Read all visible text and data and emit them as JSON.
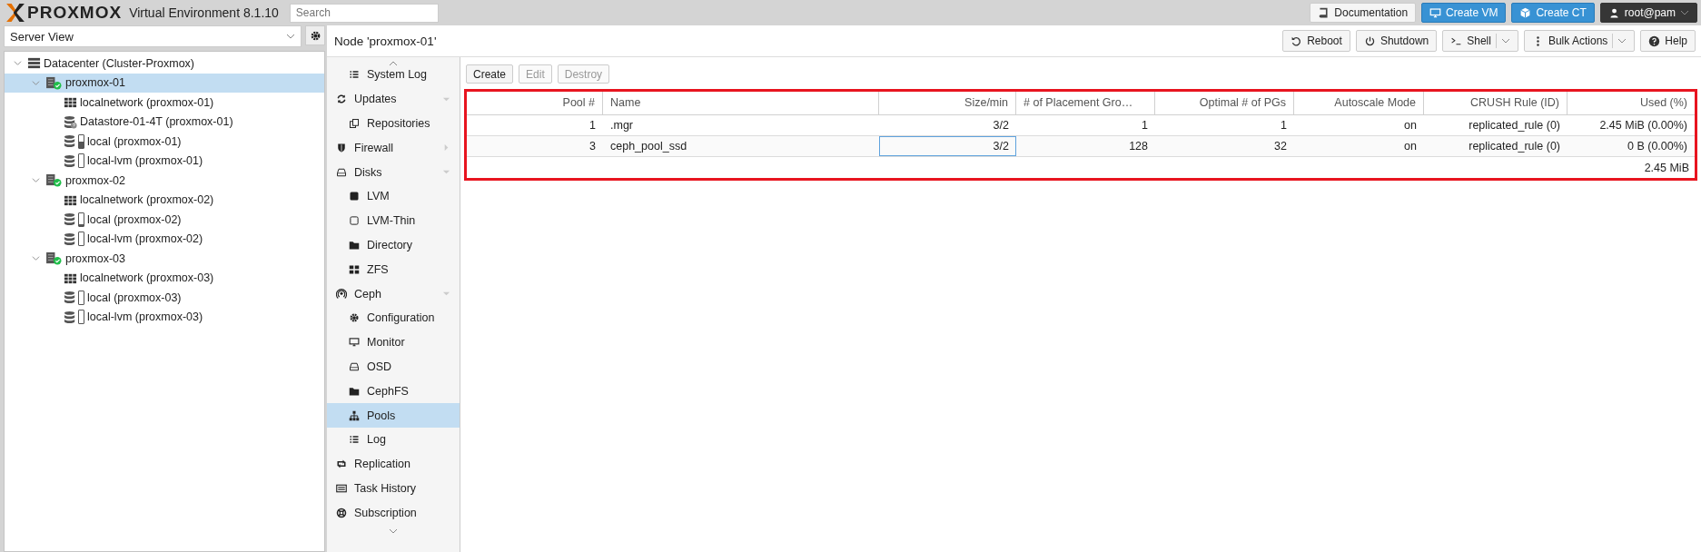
{
  "header": {
    "logo": "PROXMOX",
    "product": "Virtual Environment 8.1.10",
    "search": {
      "placeholder": "Search"
    },
    "buttons": [
      {
        "label": "Documentation",
        "kind": "plain"
      },
      {
        "label": "Create VM",
        "kind": "primary"
      },
      {
        "label": "Create CT",
        "kind": "primary"
      },
      {
        "label": "root@pam",
        "kind": "user"
      }
    ]
  },
  "resource_tree": {
    "view": "Server View",
    "items": [
      {
        "label": "Datacenter (Cluster-Proxmox)",
        "kind": "datacenter",
        "selected": false,
        "expanded": true,
        "children": [
          {
            "label": "proxmox-01",
            "kind": "node",
            "selected": true,
            "expanded": true,
            "children": [
              {
                "label": "localnetwork (proxmox-01)",
                "kind": "network",
                "selected": false
              },
              {
                "label": "Datastore-01-4T (proxmox-01)",
                "kind": "storage-unknown",
                "selected": false
              },
              {
                "label": "local (proxmox-01)",
                "kind": "storage",
                "level": 0.5,
                "selected": false
              },
              {
                "label": "local-lvm (proxmox-01)",
                "kind": "storage",
                "level": 0,
                "selected": false
              }
            ]
          },
          {
            "label": "proxmox-02",
            "kind": "node",
            "selected": false,
            "expanded": true,
            "children": [
              {
                "label": "localnetwork (proxmox-02)",
                "kind": "network",
                "selected": false
              },
              {
                "label": "local (proxmox-02)",
                "kind": "storage",
                "level": 0.1,
                "selected": false
              },
              {
                "label": "local-lvm (proxmox-02)",
                "kind": "storage",
                "level": 0,
                "selected": false
              }
            ]
          },
          {
            "label": "proxmox-03",
            "kind": "node",
            "selected": false,
            "expanded": true,
            "children": [
              {
                "label": "localnetwork (proxmox-03)",
                "kind": "network",
                "selected": false
              },
              {
                "label": "local (proxmox-03)",
                "kind": "storage",
                "level": 0,
                "selected": false
              },
              {
                "label": "local-lvm (proxmox-03)",
                "kind": "storage",
                "level": 0,
                "selected": false
              }
            ]
          }
        ]
      }
    ]
  },
  "panel": {
    "title": "Node 'proxmox-01'",
    "toolbar": [
      {
        "label": "Reboot",
        "menu": false
      },
      {
        "label": "Shutdown",
        "menu": false
      },
      {
        "label": "Shell",
        "menu": true
      },
      {
        "label": "Bulk Actions",
        "menu": true
      },
      {
        "label": "Help",
        "menu": false
      }
    ]
  },
  "nav": {
    "partial_group": [
      {
        "label": "System Log",
        "kind": "list",
        "selected": false
      }
    ],
    "items": [
      {
        "label": "Updates",
        "kind": "refresh",
        "selected": false,
        "expanded": true,
        "children": [
          {
            "label": "Repositories",
            "kind": "copy",
            "selected": false
          }
        ]
      },
      {
        "label": "Firewall",
        "kind": "shield",
        "selected": false,
        "expanded": false
      },
      {
        "label": "Disks",
        "kind": "hdd",
        "selected": false,
        "expanded": true,
        "children": [
          {
            "label": "LVM",
            "kind": "square",
            "selected": false
          },
          {
            "label": "LVM-Thin",
            "kind": "square-o",
            "selected": false
          },
          {
            "label": "Directory",
            "kind": "folder",
            "selected": false
          },
          {
            "label": "ZFS",
            "kind": "grid",
            "selected": false
          }
        ]
      },
      {
        "label": "Ceph",
        "kind": "ceph",
        "selected": false,
        "expanded": true,
        "children": [
          {
            "label": "Configuration",
            "kind": "gear",
            "selected": false
          },
          {
            "label": "Monitor",
            "kind": "monitor",
            "selected": false
          },
          {
            "label": "OSD",
            "kind": "hdd",
            "selected": false
          },
          {
            "label": "CephFS",
            "kind": "folder",
            "selected": false
          },
          {
            "label": "Pools",
            "kind": "sitemap",
            "selected": true
          },
          {
            "label": "Log",
            "kind": "list",
            "selected": false
          }
        ]
      },
      {
        "label": "Replication",
        "kind": "retweet",
        "selected": false
      },
      {
        "label": "Task History",
        "kind": "tasks",
        "selected": false
      },
      {
        "label": "Subscription",
        "kind": "lifering",
        "selected": false
      }
    ]
  },
  "pool_toolbar": [
    {
      "label": "Create",
      "disabled": false
    },
    {
      "label": "Edit",
      "disabled": true
    },
    {
      "label": "Destroy",
      "disabled": true
    }
  ],
  "pools_table": {
    "highlighted": true,
    "columns": [
      "Pool #",
      "Name",
      "Size/min",
      "# of Placement Gro…",
      "Optimal # of PGs",
      "Autoscale Mode",
      "CRUSH Rule (ID)",
      "Used (%)"
    ],
    "rows": [
      {
        "cells": [
          {
            "text": "1",
            "focused": false
          },
          {
            "text": ".mgr",
            "focused": false
          },
          {
            "text": "3/2",
            "focused": false
          },
          {
            "text": "1",
            "focused": false
          },
          {
            "text": "1",
            "focused": false
          },
          {
            "text": "on",
            "focused": false
          },
          {
            "text": "replicated_rule (0)",
            "focused": false
          },
          {
            "text": "2.45 MiB (0.00%)",
            "focused": false
          }
        ]
      },
      {
        "cells": [
          {
            "text": "3",
            "focused": false
          },
          {
            "text": "ceph_pool_ssd",
            "focused": false
          },
          {
            "text": "3/2",
            "focused": true
          },
          {
            "text": "128",
            "focused": false
          },
          {
            "text": "32",
            "focused": false
          },
          {
            "text": "on",
            "focused": false
          },
          {
            "text": "replicated_rule (0)",
            "focused": false
          },
          {
            "text": "0 B (0.00%)",
            "focused": false
          }
        ]
      }
    ],
    "summary": "2.45 MiB"
  }
}
